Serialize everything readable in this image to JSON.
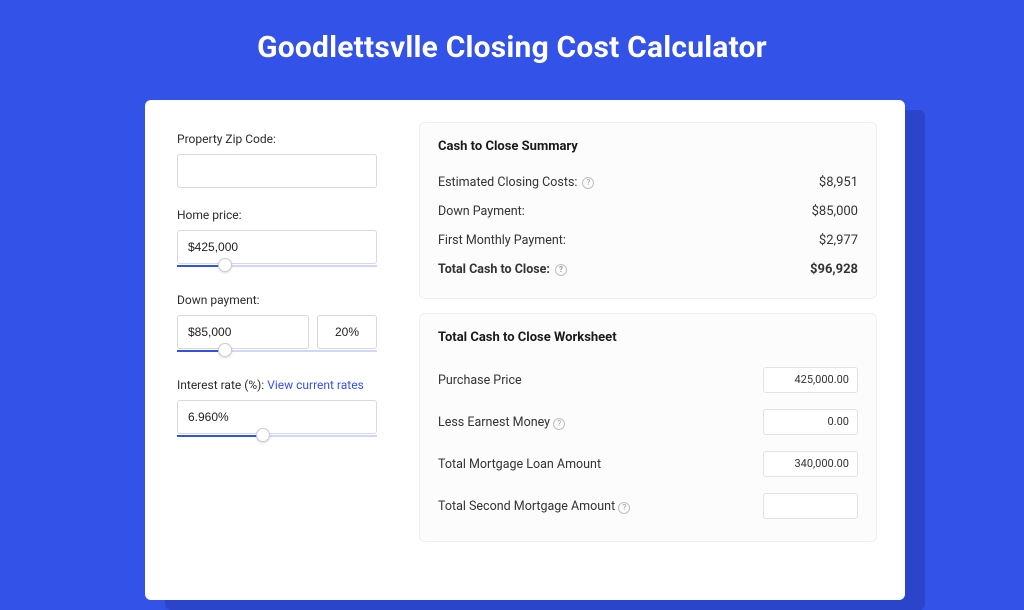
{
  "title": "Goodlettsvlle Closing Cost Calculator",
  "form": {
    "zip": {
      "label": "Property Zip Code:",
      "value": ""
    },
    "price": {
      "label": "Home price:",
      "value": "$425,000",
      "slider_pct": 24
    },
    "down": {
      "label": "Down payment:",
      "value": "$85,000",
      "pct": "20%",
      "slider_pct": 24
    },
    "rate": {
      "label": "Interest rate (%):",
      "link": "View current rates",
      "value": "6.960%",
      "slider_pct": 43
    }
  },
  "summary": {
    "title": "Cash to Close Summary",
    "rows": [
      {
        "label": "Estimated Closing Costs:",
        "help": true,
        "value": "$8,951"
      },
      {
        "label": "Down Payment:",
        "help": false,
        "value": "$85,000"
      },
      {
        "label": "First Monthly Payment:",
        "help": false,
        "value": "$2,977"
      }
    ],
    "total": {
      "label": "Total Cash to Close:",
      "help": true,
      "value": "$96,928"
    }
  },
  "worksheet": {
    "title": "Total Cash to Close Worksheet",
    "rows": [
      {
        "label": "Purchase Price",
        "help": false,
        "value": "425,000.00"
      },
      {
        "label": "Less Earnest Money",
        "help": true,
        "value": "0.00"
      },
      {
        "label": "Total Mortgage Loan Amount",
        "help": false,
        "value": "340,000.00"
      },
      {
        "label": "Total Second Mortgage Amount",
        "help": true,
        "value": ""
      }
    ]
  }
}
